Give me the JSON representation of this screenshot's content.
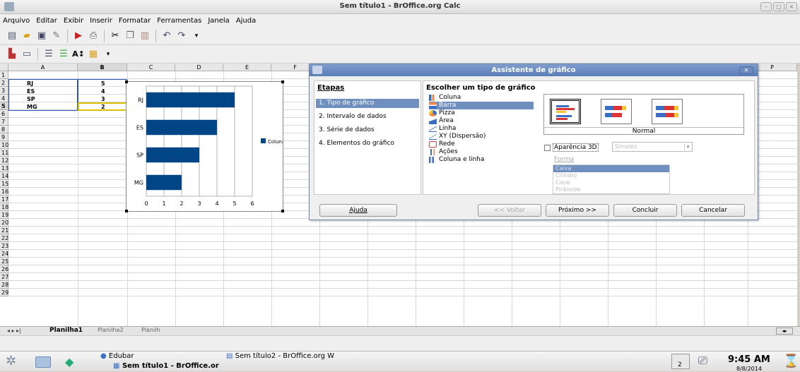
{
  "window": {
    "title": "Sem título1 - BrOffice.org Calc"
  },
  "menu": [
    "Arquivo",
    "Editar",
    "Exibir",
    "Inserir",
    "Formatar",
    "Ferramentas",
    "Janela",
    "Ajuda"
  ],
  "columns": [
    "A",
    "B",
    "C",
    "D",
    "E",
    "F",
    "P"
  ],
  "rows": [
    "1",
    "2",
    "3",
    "4",
    "5",
    "6",
    "7",
    "8",
    "9",
    "10",
    "11",
    "12",
    "13",
    "14",
    "15",
    "16",
    "17",
    "18",
    "19",
    "20",
    "21",
    "22",
    "23",
    "24",
    "25",
    "26",
    "27",
    "28",
    "29"
  ],
  "cells": [
    {
      "a": "RJ",
      "b": "5"
    },
    {
      "a": "ES",
      "b": "4"
    },
    {
      "a": "SP",
      "b": "3"
    },
    {
      "a": "MG",
      "b": "2"
    }
  ],
  "chart_data": {
    "type": "bar",
    "orientation": "horizontal",
    "categories": [
      "RJ",
      "ES",
      "SP",
      "MG"
    ],
    "series": [
      {
        "name": "Coluna B",
        "values": [
          5,
          4,
          3,
          2
        ],
        "color": "#004586"
      }
    ],
    "xticks": [
      "0",
      "1",
      "2",
      "3",
      "4",
      "5",
      "6"
    ],
    "xlim": [
      0,
      6
    ],
    "grid": true,
    "legend": "right"
  },
  "dialog": {
    "title": "Assistente de gráfico",
    "steps_heading": "Etapas",
    "steps": [
      "1. Tipo de gráfico",
      "2. Intervalo de dados",
      "3. Série de dados",
      "4. Elementos do gráfico"
    ],
    "choose_heading": "Escolher um tipo de gráfico",
    "chart_types": [
      "Coluna",
      "Barra",
      "Pizza",
      "Área",
      "Linha",
      "XY (Dispersão)",
      "Rede",
      "Ações",
      "Coluna e linha"
    ],
    "selected_type": "Barra",
    "variant_label": "Normal",
    "check_3d": "Aparência 3D",
    "select_3d": "Simples",
    "shape_label": "Forma",
    "shapes": [
      "Caixa",
      "Cilindro",
      "Cone",
      "Pirâmide"
    ],
    "buttons": {
      "help": "Ajuda",
      "back": "<< Voltar",
      "next": "Próximo >>",
      "finish": "Concluir",
      "cancel": "Cancelar"
    }
  },
  "sheet_tabs": [
    "Planilha1",
    "Planilha2",
    "Planilh"
  ],
  "taskbar": {
    "task1": "Edubar",
    "task2": "Sem título1 - BrOffice.or",
    "task3": "Sem título2 - BrOffice.org W",
    "pager": "2",
    "time": "9:45 AM",
    "date": "8/8/2014"
  },
  "colors": {
    "accent": "#6f8fbf",
    "bar": "#004586"
  }
}
